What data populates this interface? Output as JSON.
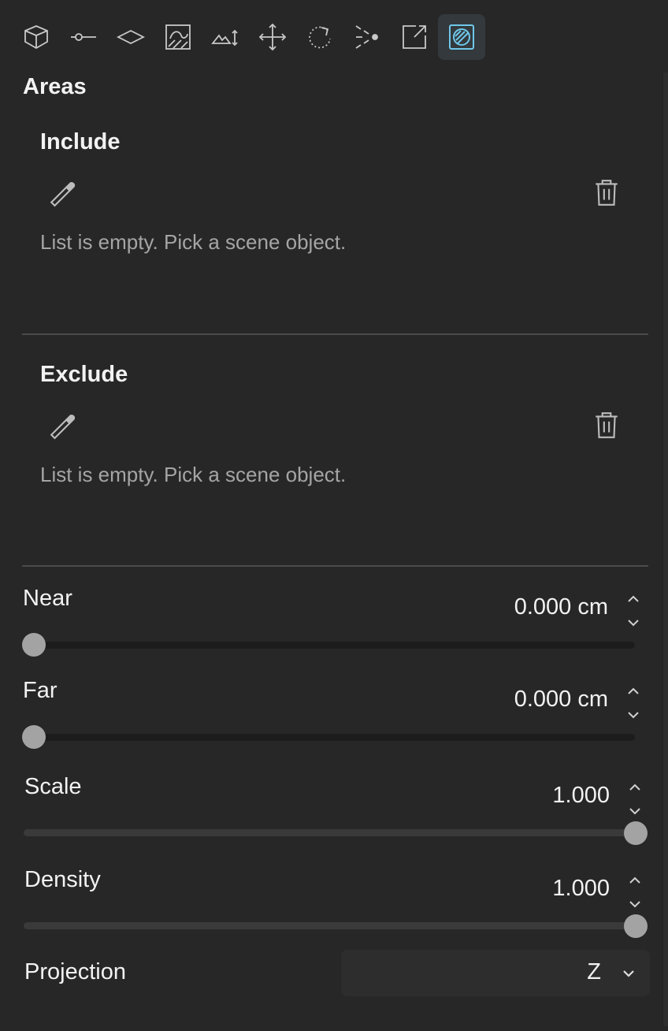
{
  "toolbar": {
    "icons": [
      "box-icon",
      "node-icon",
      "plane-icon",
      "texture-icon",
      "terrain-height-icon",
      "move-icon",
      "rotate-icon",
      "scatter-icon",
      "export-icon",
      "areas-icon"
    ],
    "active_index": 9,
    "active_color": "#6fc7ea"
  },
  "panel": {
    "heading": "Areas",
    "include": {
      "title": "Include",
      "empty_message": "List is empty. Pick a scene object."
    },
    "exclude": {
      "title": "Exclude",
      "empty_message": "List is empty. Pick a scene object."
    }
  },
  "fields": {
    "near": {
      "label": "Near",
      "value": "0.000 cm",
      "slider_fraction": 0.0
    },
    "far": {
      "label": "Far",
      "value": "0.000 cm",
      "slider_fraction": 0.0
    },
    "scale": {
      "label": "Scale",
      "value": "1.000",
      "slider_fraction": 1.0
    },
    "density": {
      "label": "Density",
      "value": "1.000",
      "slider_fraction": 1.0
    },
    "projection": {
      "label": "Projection",
      "value": "Z"
    }
  }
}
